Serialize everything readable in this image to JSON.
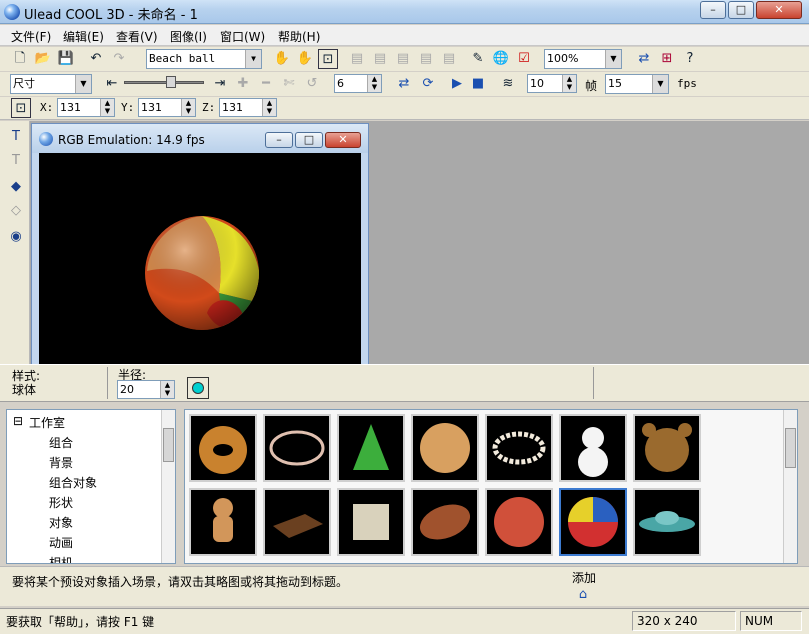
{
  "window": {
    "title": "Ulead COOL 3D - 未命名 - 1"
  },
  "menu": [
    "文件(F)",
    "编辑(E)",
    "查看(V)",
    "图像(I)",
    "窗口(W)",
    "帮助(H)"
  ],
  "toolbar1": {
    "object_select": "Beach ball",
    "zoom": "100%"
  },
  "toolbar2": {
    "attr_select": "尺寸",
    "frame_value": "6",
    "frames_total": "10",
    "frames_label": "帧",
    "fps_value": "15",
    "fps_label": "fps"
  },
  "toolbar3": {
    "x_label": "X:",
    "x_value": "131",
    "y_label": "Y:",
    "y_value": "131",
    "z_label": "Z:",
    "z_value": "131"
  },
  "preview": {
    "title": "RGB Emulation: 14.9 fps"
  },
  "attributes": {
    "style_label": "样式:",
    "style_value": "球体",
    "radius_label": "半径:",
    "radius_value": "20",
    "color_swatch": "#00d0d0"
  },
  "tree": {
    "root": "工作室",
    "items": [
      "组合",
      "背景",
      "组合对象",
      "形状",
      "对象",
      "动画",
      "相机"
    ]
  },
  "thumbnails": [
    {
      "name": "donut"
    },
    {
      "name": "ring"
    },
    {
      "name": "party-hat"
    },
    {
      "name": "bread"
    },
    {
      "name": "pearl-necklace"
    },
    {
      "name": "snowman"
    },
    {
      "name": "teddy-bear"
    },
    {
      "name": "gingerbread-man"
    },
    {
      "name": "chocolate-bar"
    },
    {
      "name": "esc-key"
    },
    {
      "name": "football"
    },
    {
      "name": "basketball"
    },
    {
      "name": "beach-ball"
    },
    {
      "name": "ufo"
    }
  ],
  "hint": {
    "text": "要将某个预设对象插入场景，请双击其略图或将其拖动到标题。",
    "add_label": "添加"
  },
  "status": {
    "help": "要获取「帮助」，请按 F1 键",
    "size": "320 x 240",
    "num": "NUM"
  },
  "colors": {
    "workspace": "#a9a9a9",
    "chrome": "#ece9d8",
    "selection": "#3d7bd0"
  }
}
